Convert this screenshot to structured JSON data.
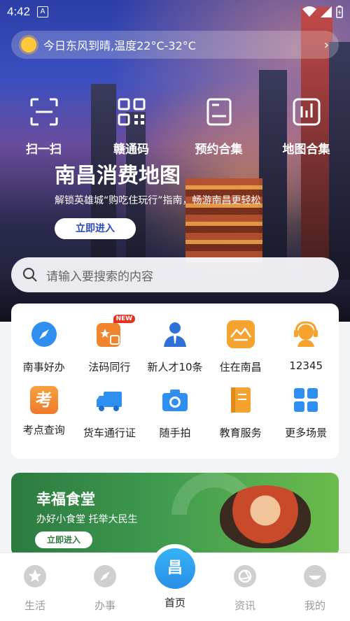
{
  "status_bar": {
    "time": "4:42",
    "notification_glyph": "A"
  },
  "weather": {
    "text": "今日东风到晴,温度22°C-32°C",
    "icon": "sun-icon"
  },
  "quick_actions": [
    {
      "label": "扫一扫",
      "icon": "scan-icon"
    },
    {
      "label": "赣通码",
      "icon": "qr-code-icon"
    },
    {
      "label": "预约合集",
      "icon": "reservation-icon"
    },
    {
      "label": "地图合集",
      "icon": "map-chart-icon"
    }
  ],
  "banner": {
    "title": "南昌消费地图",
    "subtitle": "解锁英雄城“购吃住玩行”指南，畅游南昌更轻松",
    "button": "立即进入"
  },
  "search": {
    "placeholder": "请输入要搜索的内容"
  },
  "services_row1": [
    {
      "label": "南事好办",
      "icon": "compass-icon"
    },
    {
      "label": "法码同行",
      "icon": "law-badge-icon",
      "badge": "NEW"
    },
    {
      "label": "新人才10条",
      "icon": "talent-person-icon"
    },
    {
      "label": "住在南昌",
      "icon": "housing-icon"
    },
    {
      "label": "12345",
      "icon": "hotline-headset-icon"
    }
  ],
  "services_row2": [
    {
      "label": "考点查询",
      "icon": "exam-icon",
      "glyph": "考"
    },
    {
      "label": "货车通行证",
      "icon": "truck-icon"
    },
    {
      "label": "随手拍",
      "icon": "camera-icon"
    },
    {
      "label": "教育服务",
      "icon": "education-book-icon"
    },
    {
      "label": "更多场景",
      "icon": "more-grid-icon"
    }
  ],
  "food_banner": {
    "title": "幸福食堂",
    "subtitle": "办好小食堂 托举大民生",
    "button": "立即进入"
  },
  "tabbar": {
    "items": [
      {
        "label": "生活",
        "icon": "star-icon"
      },
      {
        "label": "办事",
        "icon": "compass-icon"
      },
      {
        "label": "首页",
        "icon": "home-logo-icon",
        "active": true
      },
      {
        "label": "资讯",
        "icon": "aperture-icon"
      },
      {
        "label": "我的",
        "icon": "profile-icon"
      }
    ],
    "home_logo_glyph": "昌"
  },
  "colors": {
    "accent": "#2e4bbf",
    "tab_active": "#2a8ee8",
    "food_green": "#2c7a3f"
  }
}
